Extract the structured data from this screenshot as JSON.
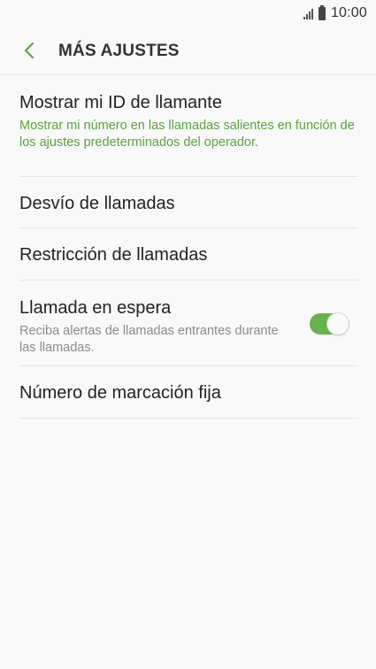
{
  "status_bar": {
    "time": "10:00",
    "icons": [
      "signal-icon",
      "battery-icon"
    ]
  },
  "app_bar": {
    "back_icon": "chevron-left-icon",
    "title": "MÁS AJUSTES"
  },
  "settings": {
    "items": [
      {
        "title": "Mostrar mi ID de llamante",
        "subtitle": "Mostrar mi número en las llamadas salientes en función de los ajustes predeterminados del operador."
      },
      {
        "title": "Desvío de llamadas"
      },
      {
        "title": "Restricción de llamadas"
      },
      {
        "title": "Llamada en espera",
        "subtitle": "Reciba alertas de llamadas entrantes durante las llamadas.",
        "toggle_on": true
      },
      {
        "title": "Número de marcación fija"
      }
    ]
  },
  "colors": {
    "accent": "#57a33c",
    "toggle_on": "#67b44c",
    "text_primary": "#222222",
    "text_secondary": "#8b8b8b",
    "background": "#f9f9f9"
  }
}
